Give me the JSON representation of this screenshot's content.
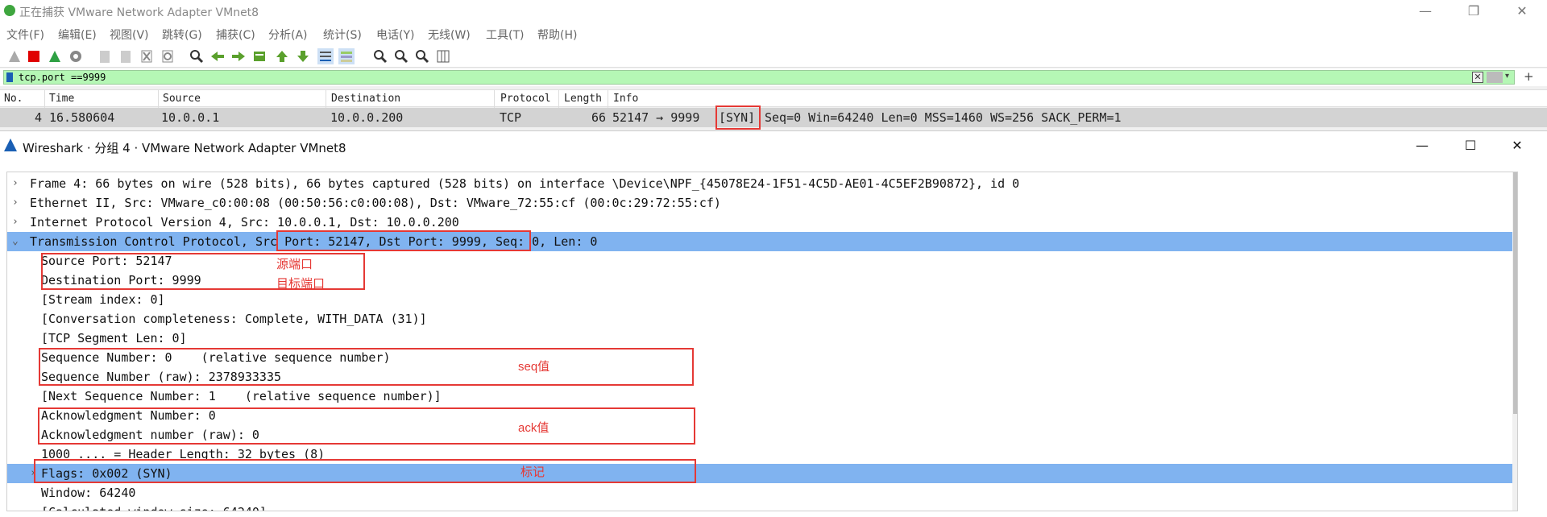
{
  "main_window": {
    "title": "正在捕获 VMware Network Adapter VMnet8",
    "controls": [
      "—",
      "❐",
      "✕"
    ]
  },
  "menu": [
    "文件(F)",
    "编辑(E)",
    "视图(V)",
    "跳转(G)",
    "捕获(C)",
    "分析(A)",
    "统计(S)",
    "电话(Y)",
    "无线(W)",
    "工具(T)",
    "帮助(H)"
  ],
  "filter": {
    "value": "tcp.port ==9999"
  },
  "packet_list": {
    "columns": [
      "No.",
      "Time",
      "Source",
      "Destination",
      "Protocol",
      "Length",
      "Info"
    ],
    "row": {
      "no": "4",
      "time": "16.580604",
      "source": "10.0.0.1",
      "destination": "10.0.0.200",
      "protocol": "TCP",
      "length": "66",
      "info_a": "52147 → 9999",
      "info_flag": "[SYN]",
      "info_b": "Seq=0 Win=64240 Len=0 MSS=1460 WS=256 SACK_PERM=1"
    }
  },
  "detail_window": {
    "title": "Wireshark · 分组 4 · VMware Network Adapter VMnet8",
    "controls": [
      "—",
      "☐",
      "✕"
    ]
  },
  "tree": {
    "frame": "Frame 4: 66 bytes on wire (528 bits), 66 bytes captured (528 bits) on interface \\Device\\NPF_{45078E24-1F51-4C5D-AE01-4C5EF2B90872}, id 0",
    "ethernet": "Ethernet II, Src: VMware_c0:00:08 (00:50:56:c0:00:08), Dst: VMware_72:55:cf (00:0c:29:72:55:cf)",
    "ip": "Internet Protocol Version 4, Src: 10.0.0.1, Dst: 10.0.0.200",
    "tcp_a": "Transmission Control Protocol, ",
    "tcp_ports": "Src Port: 52147, Dst Port: 9999",
    "tcp_b": ", Seq: 0, Len: 0",
    "src_port": "Source Port: 52147",
    "dst_port": "Destination Port: 9999",
    "stream": "[Stream index: 0]",
    "conv": "[Conversation completeness: Complete, WITH_DATA (31)]",
    "seglen": "[TCP Segment Len: 0]",
    "seq": "Sequence Number: 0    (relative sequence number)",
    "seq_raw": "Sequence Number (raw): 2378933335",
    "next_seq": "[Next Sequence Number: 1    (relative sequence number)]",
    "ack": "Acknowledgment Number: 0",
    "ack_raw": "Acknowledgment number (raw): 0",
    "hdr_len": "1000 .... = Header Length: 32 bytes (8)",
    "flags": "Flags: 0x002 (SYN)",
    "window": "Window: 64240",
    "calc_window": "[Calculated window size: 64240]"
  },
  "annotations": {
    "src_port": "源端口",
    "dst_port": "目标端口",
    "seq": "seq值",
    "ack": "ack值",
    "flags": "标记"
  }
}
